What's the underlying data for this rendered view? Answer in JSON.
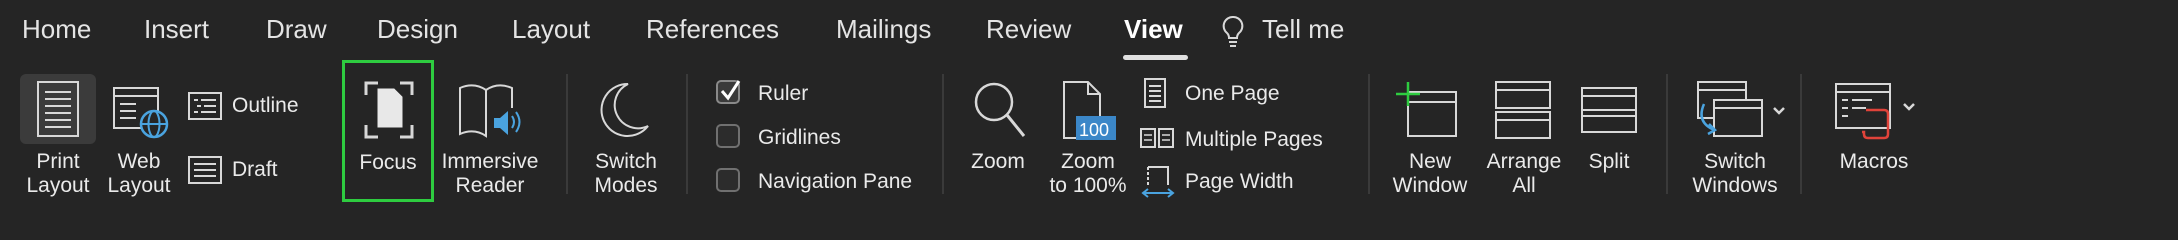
{
  "tabs": [
    {
      "label": "Home"
    },
    {
      "label": "Insert"
    },
    {
      "label": "Draw"
    },
    {
      "label": "Design"
    },
    {
      "label": "Layout"
    },
    {
      "label": "References"
    },
    {
      "label": "Mailings"
    },
    {
      "label": "Review"
    },
    {
      "label": "View"
    }
  ],
  "active_tab": "View",
  "tell_me": {
    "label": "Tell me",
    "icon": "lightbulb-icon"
  },
  "ribbon": {
    "views": {
      "print_layout": {
        "line1": "Print",
        "line2": "Layout"
      },
      "web_layout": {
        "line1": "Web",
        "line2": "Layout"
      },
      "outline": "Outline",
      "draft": "Draft"
    },
    "focus": {
      "label": "Focus",
      "highlight_color": "#2ecc40"
    },
    "immersive_reader": {
      "line1": "Immersive",
      "line2": "Reader"
    },
    "switch_modes": {
      "line1": "Switch",
      "line2": "Modes"
    },
    "show": {
      "ruler": {
        "label": "Ruler",
        "checked": true
      },
      "gridlines": {
        "label": "Gridlines",
        "checked": false
      },
      "navigation_pane": {
        "label": "Navigation Pane",
        "checked": false
      }
    },
    "zoom": {
      "zoom": "Zoom",
      "zoom100": {
        "line1": "Zoom",
        "line2": "to 100%",
        "badge": "100"
      },
      "one_page": "One Page",
      "multiple_pages": "Multiple Pages",
      "page_width": "Page Width"
    },
    "window": {
      "new_window": {
        "line1": "New",
        "line2": "Window"
      },
      "arrange_all": {
        "line1": "Arrange",
        "line2": "All"
      },
      "split": "Split",
      "switch_windows": {
        "line1": "Switch",
        "line2": "Windows"
      }
    },
    "macros": "Macros"
  }
}
